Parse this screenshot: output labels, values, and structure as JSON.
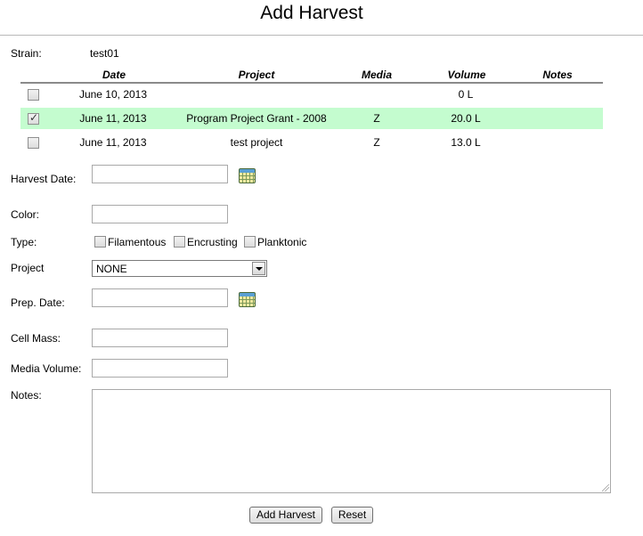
{
  "page": {
    "title": "Add Harvest"
  },
  "strain": {
    "label": "Strain:",
    "value": "test01"
  },
  "table": {
    "columns": [
      "Date",
      "Project",
      "Media",
      "Volume",
      "Notes"
    ],
    "rows": [
      {
        "date": "June 10, 2013",
        "project": "",
        "media": "",
        "volume": "0 L",
        "notes": "",
        "checked": false
      },
      {
        "date": "June 11, 2013",
        "project": "Program Project Grant - 2008",
        "media": "Z",
        "volume": "20.0 L",
        "notes": "",
        "checked": true
      },
      {
        "date": "June 11, 2013",
        "project": "test project",
        "media": "Z",
        "volume": "13.0 L",
        "notes": "",
        "checked": false
      }
    ],
    "selected_row_color": "#c4fccf"
  },
  "form": {
    "harvest_date": {
      "label": "Harvest Date:",
      "value": "",
      "icon": "calendar-icon"
    },
    "color": {
      "label": "Color:",
      "value": ""
    },
    "type": {
      "label": "Type:",
      "options": [
        {
          "label": "Filamentous",
          "checked": false
        },
        {
          "label": "Encrusting",
          "checked": false
        },
        {
          "label": "Planktonic",
          "checked": false
        }
      ]
    },
    "project": {
      "label": "Project",
      "selected": "NONE"
    },
    "prep_date": {
      "label": "Prep. Date:",
      "value": "",
      "icon": "calendar-icon"
    },
    "cell_mass": {
      "label": "Cell Mass:",
      "value": ""
    },
    "media_volume": {
      "label": "Media Volume:",
      "value": ""
    },
    "notes": {
      "label": "Notes:",
      "value": ""
    }
  },
  "buttons": {
    "submit": "Add Harvest",
    "reset": "Reset"
  }
}
